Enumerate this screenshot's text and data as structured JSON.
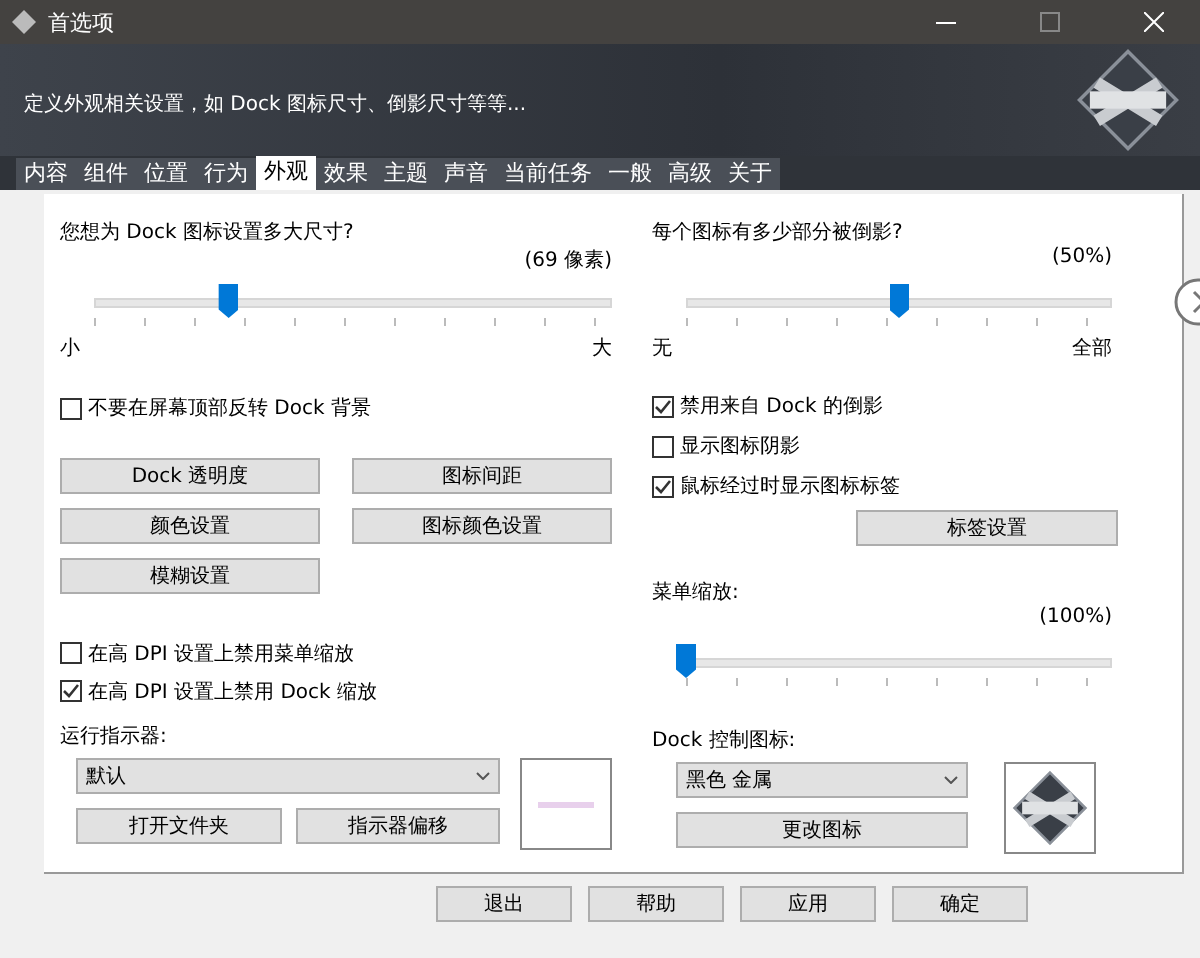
{
  "window": {
    "title": "首选项"
  },
  "header": {
    "description": "定义外观相关设置，如 Dock 图标尺寸、倒影尺寸等等..."
  },
  "tabs": [
    {
      "label": "内容",
      "selected": false
    },
    {
      "label": "组件",
      "selected": false
    },
    {
      "label": "位置",
      "selected": false
    },
    {
      "label": "行为",
      "selected": false
    },
    {
      "label": "外观",
      "selected": true
    },
    {
      "label": "效果",
      "selected": false
    },
    {
      "label": "主题",
      "selected": false
    },
    {
      "label": "声音",
      "selected": false
    },
    {
      "label": "当前任务",
      "selected": false
    },
    {
      "label": "一般",
      "selected": false
    },
    {
      "label": "高级",
      "selected": false
    },
    {
      "label": "关于",
      "selected": false
    }
  ],
  "left": {
    "icon_size": {
      "question": "您想为 Dock 图标设置多大尺寸?",
      "reading": "(69 像素)",
      "level": 0.26,
      "min_label": "小",
      "max_label": "大"
    },
    "checkbox_top": {
      "label": "不要在屏幕顶部反转 Dock 背景",
      "checked": false
    },
    "buttons": [
      "Dock 透明度",
      "图标间距",
      "颜色设置",
      "图标颜色设置",
      "模糊设置"
    ],
    "checkboxes": [
      {
        "label": "在高 DPI 设置上禁用菜单缩放",
        "checked": false
      },
      {
        "label": "在高 DPI 设置上禁用 Dock 缩放",
        "checked": true
      }
    ],
    "indicator": {
      "label": "运行指示器:",
      "value": "默认",
      "buttons": [
        "打开文件夹",
        "指示器偏移"
      ]
    }
  },
  "right": {
    "reflection": {
      "question": "每个图标有多少部分被倒影?",
      "reading": "(50%)",
      "level": 0.5,
      "min_label": "无",
      "max_label": "全部"
    },
    "checkboxes": [
      {
        "label": "禁用来自 Dock 的倒影",
        "checked": true
      },
      {
        "label": "显示图标阴影",
        "checked": false
      },
      {
        "label": "鼠标经过时显示图标标签",
        "checked": true
      }
    ],
    "label_button": "标签设置",
    "menu_scale": {
      "question": "菜单缩放:",
      "reading": "(100%)",
      "level": 0
    },
    "dock_icon": {
      "label": "Dock 控制图标:",
      "value": "黑色 金属",
      "button": "更改图标"
    }
  },
  "footer": {
    "buttons": [
      "退出",
      "帮助",
      "应用",
      "确定"
    ]
  }
}
